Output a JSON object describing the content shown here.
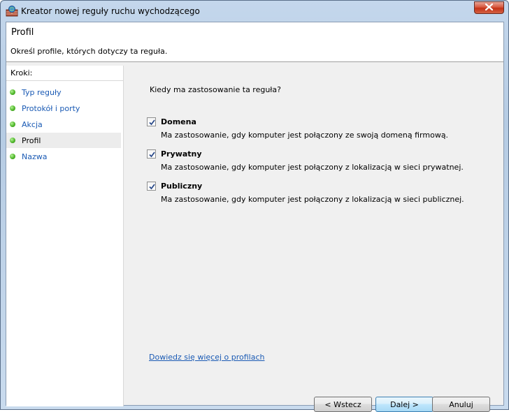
{
  "window": {
    "title": "Kreator nowej reguły ruchu wychodzącego",
    "close_glyph": "✕"
  },
  "header": {
    "title": "Profil",
    "subtitle": "Określ profile, których dotyczy ta reguła."
  },
  "steps": {
    "header": "Kroki:",
    "items": [
      {
        "label": "Typ reguły",
        "active": false
      },
      {
        "label": "Protokół i porty",
        "active": false
      },
      {
        "label": "Akcja",
        "active": false
      },
      {
        "label": "Profil",
        "active": true
      },
      {
        "label": "Nazwa",
        "active": false
      }
    ]
  },
  "main": {
    "question": "Kiedy ma zastosowanie ta reguła?",
    "profiles": [
      {
        "name": "Domena",
        "checked": true,
        "description": "Ma zastosowanie, gdy komputer jest połączony ze swoją domeną firmową."
      },
      {
        "name": "Prywatny",
        "checked": true,
        "description": "Ma zastosowanie, gdy komputer jest połączony z lokalizacją w sieci prywatnej."
      },
      {
        "name": "Publiczny",
        "checked": true,
        "description": "Ma zastosowanie, gdy komputer jest połączony z lokalizacją w sieci publicznej."
      }
    ],
    "learn_more_link": "Dowiedz się więcej o profilach"
  },
  "buttons": {
    "back": "< Wstecz",
    "next": "Dalej >",
    "cancel": "Anuluj"
  },
  "colors": {
    "link": "#1a5ab4",
    "step_dot": "#4fb82a"
  }
}
